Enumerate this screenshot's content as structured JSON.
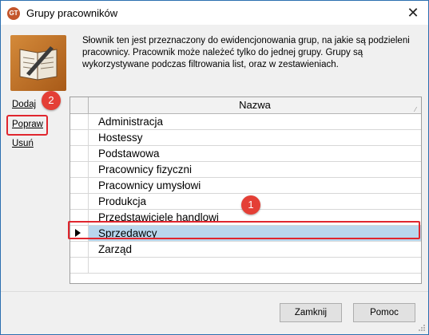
{
  "window": {
    "title": "Grupy pracowników",
    "icon": "app-logo-icon",
    "icon_label": "GT"
  },
  "description": "Słownik ten jest przeznaczony do ewidencjonowania grup, na jakie są podzieleni pracownicy. Pracownik może należeć tylko do jednej grupy. Grupy są wykorzystywane podczas filtrowania list, oraz w zestawieniach.",
  "side_actions": {
    "add": "Dodaj",
    "edit": "Popraw",
    "delete": "Usuń"
  },
  "grid": {
    "column_header": "Nazwa",
    "rows": [
      "Administracja",
      "Hostessy",
      "Podstawowa",
      "Pracownicy fizyczni",
      "Pracownicy umysłowi",
      "Produkcja",
      "Przedstawiciele handlowi",
      "Sprzedawcy",
      "Zarząd"
    ],
    "selected_index": 7
  },
  "annotations": {
    "badge_1": "1",
    "badge_2": "2"
  },
  "buttons": {
    "close": "Zamknij",
    "help": "Pomoc"
  },
  "colors": {
    "selection": "#b9d7ee",
    "highlight": "#e0262e",
    "badge": "#e43f36"
  }
}
